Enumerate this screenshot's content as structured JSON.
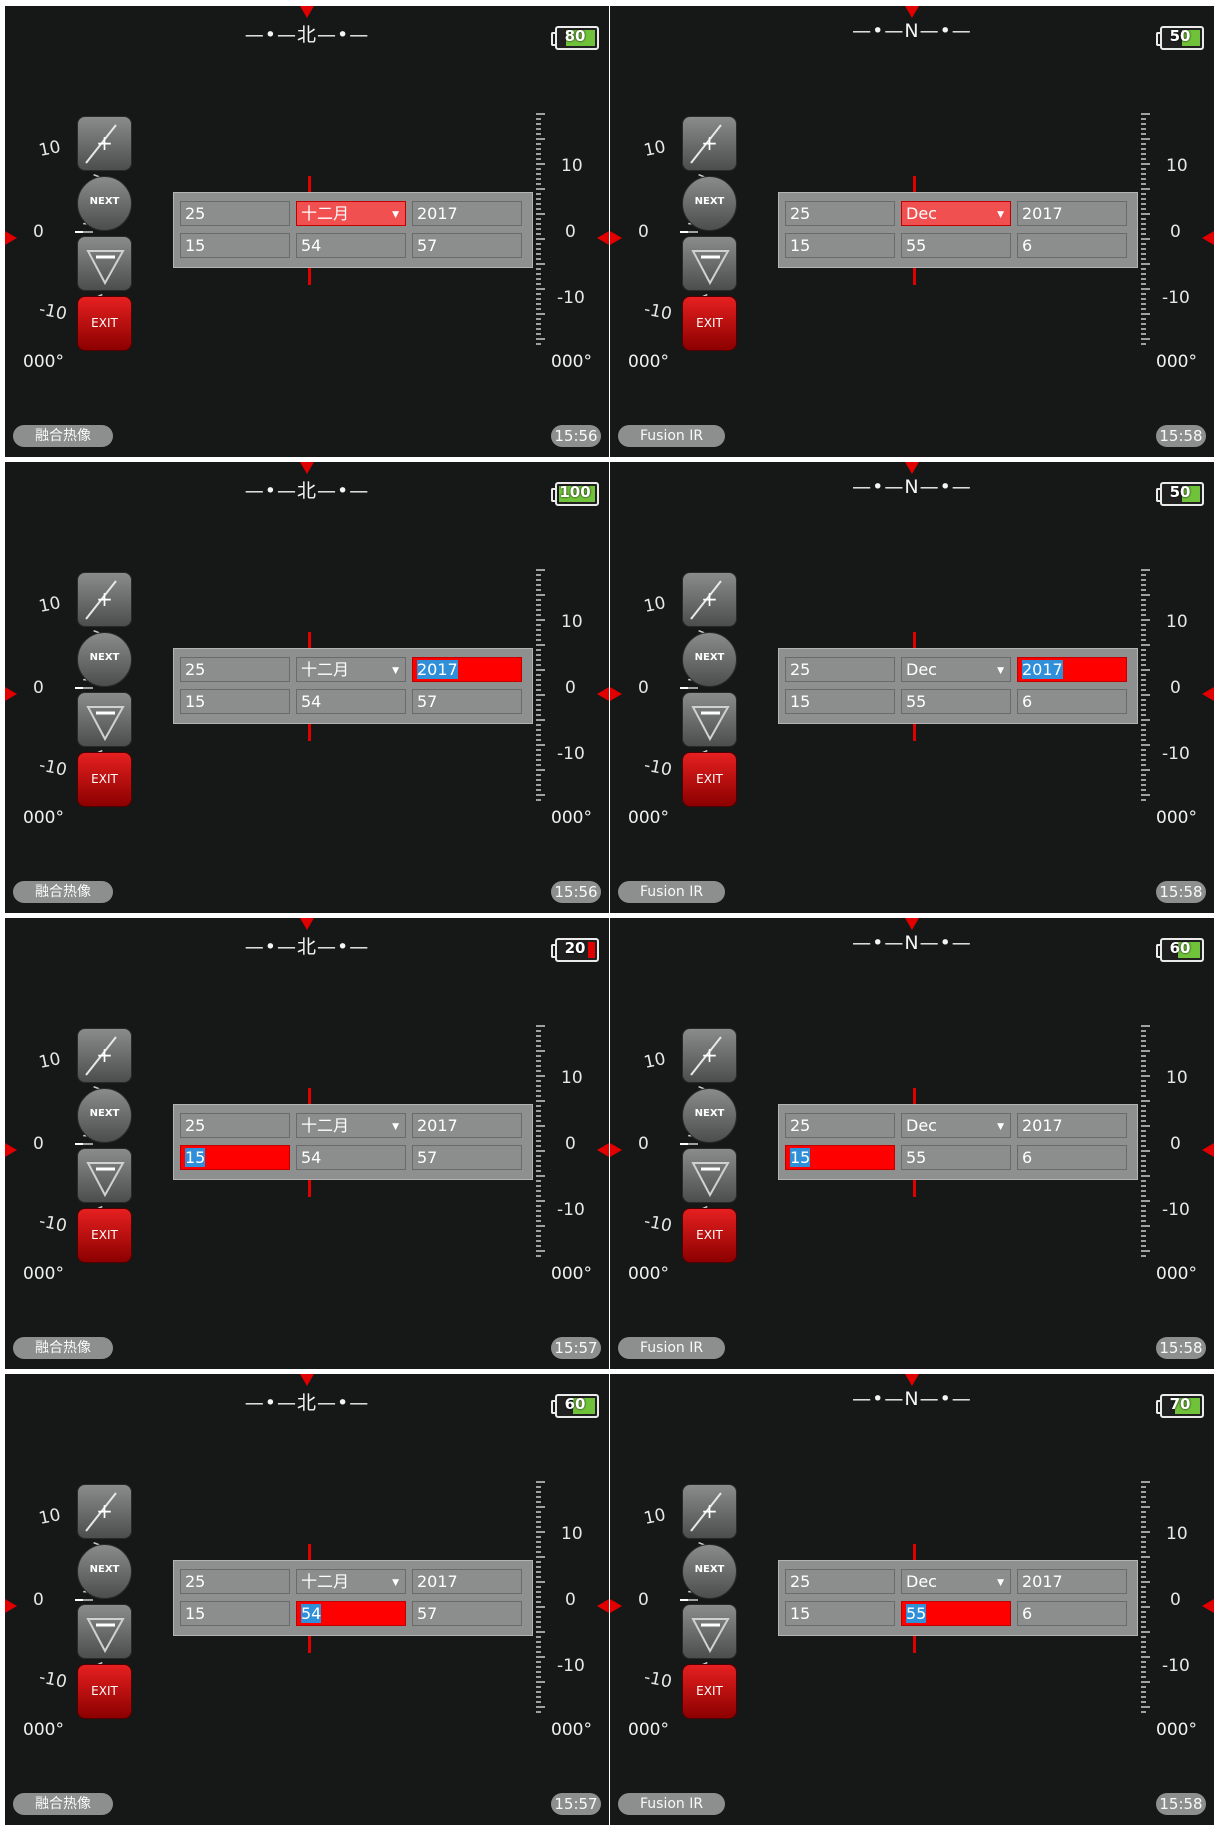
{
  "common": {
    "next_label": "NEXT",
    "exit_label": "EXIT",
    "plus_symbol": "+",
    "left_scale": [
      "10",
      "0",
      "-10"
    ],
    "right_scale": [
      "10",
      "0",
      "-10"
    ],
    "heading": "000°",
    "battery_color": "#6fc23a",
    "battery_low_color": "#e00000",
    "highlight_color": "#ff0000"
  },
  "panels": [
    {
      "compass": "—•—北—•—",
      "battery": "80",
      "mode": "融合热像",
      "time": "15:56",
      "fields": {
        "day": "25",
        "month": "十二月",
        "year": "2017",
        "hour": "15",
        "minute": "54",
        "second": "57"
      },
      "selected": "month"
    },
    {
      "compass": "—•—N—•—",
      "battery": "50",
      "mode": "Fusion IR",
      "time": "15:58",
      "fields": {
        "day": "25",
        "month": "Dec",
        "year": "2017",
        "hour": "15",
        "minute": "55",
        "second": "6"
      },
      "selected": "month"
    },
    {
      "compass": "—•—北—•—",
      "battery": "100",
      "mode": "融合热像",
      "time": "15:56",
      "fields": {
        "day": "25",
        "month": "十二月",
        "year": "2017",
        "hour": "15",
        "minute": "54",
        "second": "57"
      },
      "selected": "year"
    },
    {
      "compass": "—•—N—•—",
      "battery": "50",
      "mode": "Fusion IR",
      "time": "15:58",
      "fields": {
        "day": "25",
        "month": "Dec",
        "year": "2017",
        "hour": "15",
        "minute": "55",
        "second": "6"
      },
      "selected": "year"
    },
    {
      "compass": "—•—北—•—",
      "battery": "20",
      "mode": "融合热像",
      "time": "15:57",
      "fields": {
        "day": "25",
        "month": "十二月",
        "year": "2017",
        "hour": "15",
        "minute": "54",
        "second": "57"
      },
      "selected": "hour"
    },
    {
      "compass": "—•—N—•—",
      "battery": "60",
      "mode": "Fusion IR",
      "time": "15:58",
      "fields": {
        "day": "25",
        "month": "Dec",
        "year": "2017",
        "hour": "15",
        "minute": "55",
        "second": "6"
      },
      "selected": "hour"
    },
    {
      "compass": "—•—北—•—",
      "battery": "60",
      "mode": "融合热像",
      "time": "15:57",
      "fields": {
        "day": "25",
        "month": "十二月",
        "year": "2017",
        "hour": "15",
        "minute": "54",
        "second": "57"
      },
      "selected": "minute"
    },
    {
      "compass": "—•—N—•—",
      "battery": "70",
      "mode": "Fusion IR",
      "time": "15:58",
      "fields": {
        "day": "25",
        "month": "Dec",
        "year": "2017",
        "hour": "15",
        "minute": "55",
        "second": "6"
      },
      "selected": "minute"
    }
  ]
}
